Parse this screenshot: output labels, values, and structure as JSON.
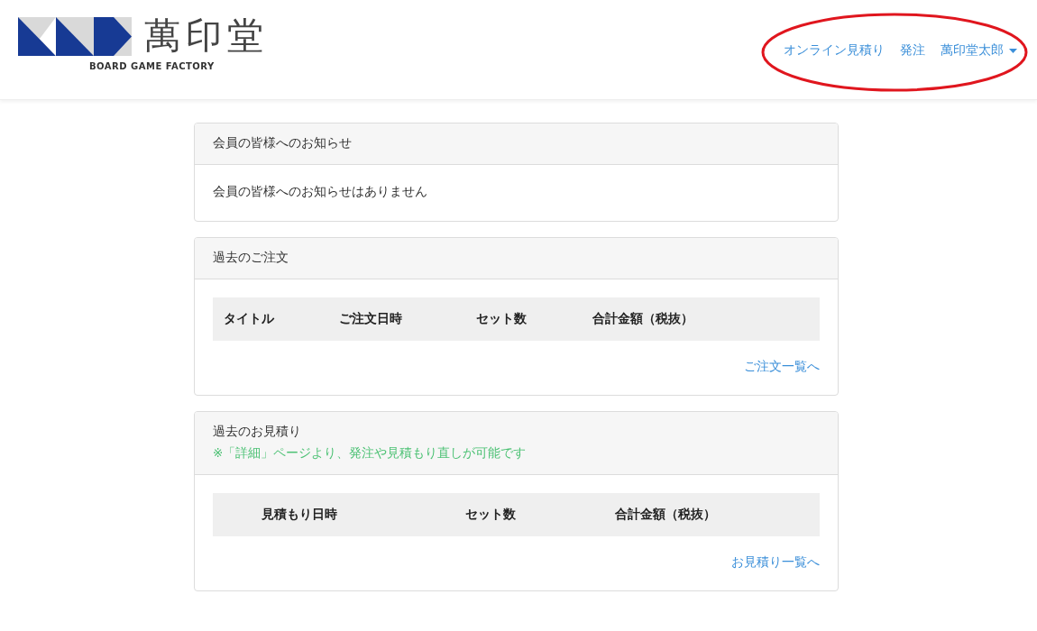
{
  "header": {
    "logo": {
      "name": "萬印堂",
      "tagline": "BOARD GAME FACTORY"
    },
    "nav": [
      {
        "label": "オンライン見積り",
        "dropdown": false
      },
      {
        "label": "発注",
        "dropdown": false
      },
      {
        "label": "萬印堂太郎",
        "dropdown": true
      }
    ],
    "annotation": {
      "kind": "ellipse",
      "color": "#e0161e"
    }
  },
  "cards": [
    {
      "title": "会員の皆様へのお知らせ",
      "message": "会員の皆様へのお知らせはありません"
    },
    {
      "title": "過去のご注文",
      "table": {
        "columns": [
          "タイトル",
          "ご注文日時",
          "セット数",
          "合計金額（税抜）"
        ]
      },
      "link": "ご注文一覧へ"
    },
    {
      "title": "過去のお見積り",
      "note": "※「詳細」ページより、発注や見積もり直しが可能です",
      "table": {
        "columns": [
          "見積もり日時",
          "セット数",
          "合計金額（税抜）"
        ]
      },
      "link": "お見積り一覧へ"
    }
  ]
}
